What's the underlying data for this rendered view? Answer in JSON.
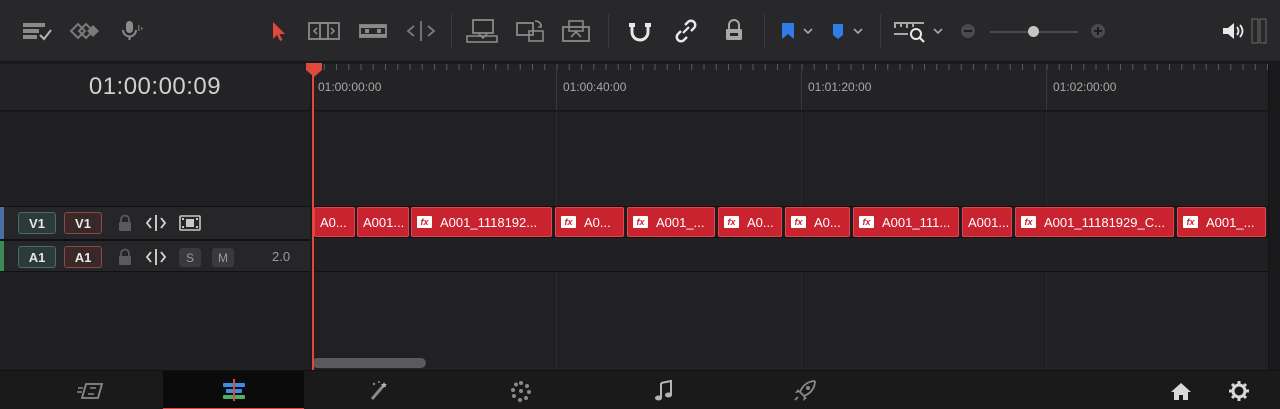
{
  "timeline": {
    "timecode": "01:00:00:09",
    "ruler_labels": [
      {
        "text": "01:00:00:00"
      },
      {
        "text": "01:00:40:00"
      },
      {
        "text": "01:01:20:00"
      },
      {
        "text": "01:02:00:00"
      }
    ]
  },
  "tracks": {
    "video": {
      "dest_label": "V1",
      "source_label": "V1",
      "color": "#4a6fa5"
    },
    "audio": {
      "dest_label": "A1",
      "source_label": "A1",
      "solo_label": "S",
      "mute_label": "M",
      "channels": "2.0",
      "color": "#3e8a55"
    }
  },
  "clips": [
    {
      "label": "A0...",
      "fx": false
    },
    {
      "label": "A001...",
      "fx": false
    },
    {
      "label": "A001_1118192...",
      "fx": true
    },
    {
      "label": "A0...",
      "fx": true
    },
    {
      "label": "A001_...",
      "fx": true
    },
    {
      "label": "A0...",
      "fx": true
    },
    {
      "label": "A0...",
      "fx": true
    },
    {
      "label": "A001_111...",
      "fx": true
    },
    {
      "label": "A001...",
      "fx": false
    },
    {
      "label": "A001_11181929_C...",
      "fx": true
    },
    {
      "label": "A001_...",
      "fx": true
    }
  ],
  "colors": {
    "accent": "#e0483c",
    "clip": "#c8232f",
    "blue_flag": "#2f7ee8"
  },
  "zoom": {
    "level": 0.45
  },
  "pagebar": {
    "active_page": "edit",
    "pages": [
      "cut-icon",
      "edit-icon",
      "fusion-icon",
      "color-icon",
      "fairlight-icon",
      "deliver-icon"
    ]
  }
}
